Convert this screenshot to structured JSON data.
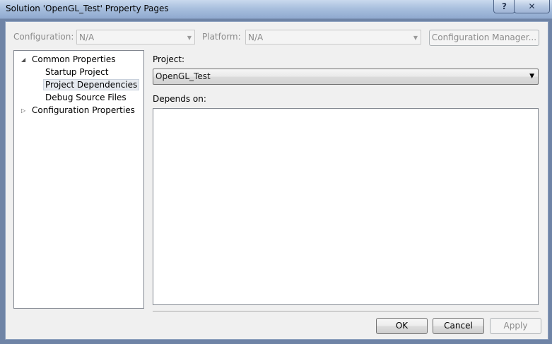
{
  "window": {
    "title": "Solution 'OpenGL_Test' Property Pages",
    "help_glyph": "?",
    "close_glyph": "✕"
  },
  "toolbar": {
    "configuration_label": "Configuration:",
    "configuration_value": "N/A",
    "platform_label": "Platform:",
    "platform_value": "N/A",
    "config_manager_label": "Configuration Manager..."
  },
  "tree": {
    "expanded_glyph": "◢",
    "collapsed_glyph": "▷",
    "items": [
      {
        "label": "Common Properties"
      },
      {
        "label": "Startup Project"
      },
      {
        "label": "Project Dependencies"
      },
      {
        "label": "Debug Source Files"
      },
      {
        "label": "Configuration Properties"
      }
    ]
  },
  "main": {
    "project_label": "Project:",
    "project_value": "OpenGL_Test",
    "depends_label": "Depends on:",
    "dropdown_glyph": "▼"
  },
  "footer": {
    "ok_label": "OK",
    "cancel_label": "Cancel",
    "apply_label": "Apply"
  }
}
